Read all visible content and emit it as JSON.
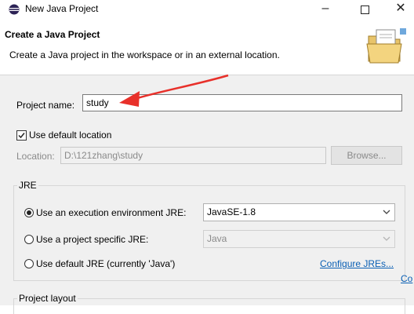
{
  "window": {
    "title": "New Java Project"
  },
  "banner": {
    "title": "Create a Java Project",
    "description": "Create a Java project in the workspace or in an external location."
  },
  "project": {
    "name_label": "Project name:",
    "name_value": "study",
    "use_default_label": "Use default location",
    "use_default_checked": true,
    "location_label": "Location:",
    "location_value": "D:\\121zhang\\study",
    "browse_label": "Browse..."
  },
  "jre": {
    "group_label": "JRE",
    "options": [
      {
        "label": "Use an execution environment JRE:",
        "selected": true,
        "combo_value": "JavaSE-1.8"
      },
      {
        "label": "Use a project specific JRE:",
        "selected": false,
        "combo_value": "Java"
      },
      {
        "label": "Use default JRE (currently 'Java')",
        "selected": false
      }
    ],
    "configure_link": "Configure JREs...",
    "partial_link": "Co"
  },
  "layout": {
    "group_label": "Project layout"
  },
  "colors": {
    "arrow": "#e8302a",
    "link": "#0a5fb4"
  }
}
